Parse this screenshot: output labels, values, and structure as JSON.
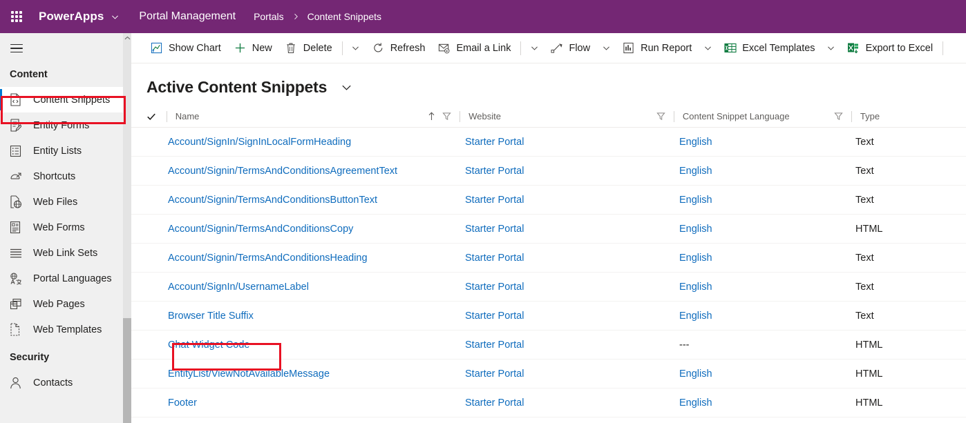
{
  "topbar": {
    "waffle_icon": "app-launcher-icon",
    "brand": "PowerApps",
    "brand_caret_icon": "chevron-down-icon",
    "app_name": "Portal Management",
    "breadcrumb": [
      {
        "label": "Portals"
      },
      {
        "label": "Content Snippets"
      }
    ],
    "breadcrumb_sep_icon": "chevron-right-icon",
    "bg_color": "#742774"
  },
  "sidebar": {
    "hamburger_icon": "hamburger-menu-icon",
    "groups": [
      {
        "title": "Content",
        "items": [
          {
            "label": "Content Snippets",
            "icon": "code-file-icon",
            "selected": true
          },
          {
            "label": "Entity Forms",
            "icon": "form-edit-icon",
            "selected": false
          },
          {
            "label": "Entity Lists",
            "icon": "list-icon",
            "selected": false
          },
          {
            "label": "Shortcuts",
            "icon": "shortcut-arrow-icon",
            "selected": false
          },
          {
            "label": "Web Files",
            "icon": "web-file-icon",
            "selected": false
          },
          {
            "label": "Web Forms",
            "icon": "web-form-icon",
            "selected": false
          },
          {
            "label": "Web Link Sets",
            "icon": "link-set-icon",
            "selected": false
          },
          {
            "label": "Portal Languages",
            "icon": "language-icon",
            "selected": false
          },
          {
            "label": "Web Pages",
            "icon": "pages-icon",
            "selected": false
          },
          {
            "label": "Web Templates",
            "icon": "template-icon",
            "selected": false
          }
        ]
      },
      {
        "title": "Security",
        "items": [
          {
            "label": "Contacts",
            "icon": "person-icon",
            "selected": false
          }
        ]
      }
    ],
    "selection_accent_color": "#0078d4",
    "scrollbar": {
      "up_arrow_icon": "chevron-up-icon"
    }
  },
  "command_bar": {
    "items": [
      {
        "label": "Show Chart",
        "icon": "chart-icon",
        "caret": false
      },
      {
        "label": "New",
        "icon": "plus-icon",
        "caret": false
      },
      {
        "label": "Delete",
        "icon": "trash-icon",
        "caret": true,
        "divider_before_caret": true
      },
      {
        "label": "Refresh",
        "icon": "refresh-icon",
        "caret": false
      },
      {
        "label": "Email a Link",
        "icon": "email-link-icon",
        "caret": true,
        "divider_before_caret": true
      },
      {
        "label": "Flow",
        "icon": "flow-icon",
        "caret": true
      },
      {
        "label": "Run Report",
        "icon": "report-icon",
        "caret": true
      },
      {
        "label": "Excel Templates",
        "icon": "excel-template-icon",
        "caret": true
      },
      {
        "label": "Export to Excel",
        "icon": "excel-export-icon",
        "caret": false
      }
    ]
  },
  "view": {
    "title": "Active Content Snippets",
    "caret_icon": "chevron-down-icon"
  },
  "grid": {
    "select_all_icon": "checkmark-icon",
    "sort_ascending_icon": "arrow-up-icon",
    "filter_icon": "filter-icon",
    "columns": [
      {
        "key": "name",
        "label": "Name",
        "sorted": true,
        "filterable": true
      },
      {
        "key": "website",
        "label": "Website",
        "sorted": false,
        "filterable": true
      },
      {
        "key": "language",
        "label": "Content Snippet Language",
        "sorted": false,
        "filterable": true
      },
      {
        "key": "type",
        "label": "Type",
        "sorted": false,
        "filterable": false
      }
    ],
    "rows": [
      {
        "name": "Account/SignIn/SignInLocalFormHeading",
        "website": "Starter Portal",
        "language": "English",
        "type": "Text",
        "highlighted": false
      },
      {
        "name": "Account/Signin/TermsAndConditionsAgreementText",
        "website": "Starter Portal",
        "language": "English",
        "type": "Text",
        "highlighted": false
      },
      {
        "name": "Account/Signin/TermsAndConditionsButtonText",
        "website": "Starter Portal",
        "language": "English",
        "type": "Text",
        "highlighted": false
      },
      {
        "name": "Account/Signin/TermsAndConditionsCopy",
        "website": "Starter Portal",
        "language": "English",
        "type": "HTML",
        "highlighted": false
      },
      {
        "name": "Account/Signin/TermsAndConditionsHeading",
        "website": "Starter Portal",
        "language": "English",
        "type": "Text",
        "highlighted": false
      },
      {
        "name": "Account/SignIn/UsernameLabel",
        "website": "Starter Portal",
        "language": "English",
        "type": "Text",
        "highlighted": false
      },
      {
        "name": "Browser Title Suffix",
        "website": "Starter Portal",
        "language": "English",
        "type": "Text",
        "highlighted": false
      },
      {
        "name": "Chat Widget Code",
        "website": "Starter Portal",
        "language": "---",
        "type": "HTML",
        "highlighted": true
      },
      {
        "name": "EntityList/ViewNotAvailableMessage",
        "website": "Starter Portal",
        "language": "English",
        "type": "HTML",
        "highlighted": false
      },
      {
        "name": "Footer",
        "website": "Starter Portal",
        "language": "English",
        "type": "HTML",
        "highlighted": false
      }
    ]
  },
  "annotations": {
    "color": "#e81123",
    "targets": [
      "sidebar-item-content-snippets",
      "row-chat-widget-code"
    ]
  }
}
